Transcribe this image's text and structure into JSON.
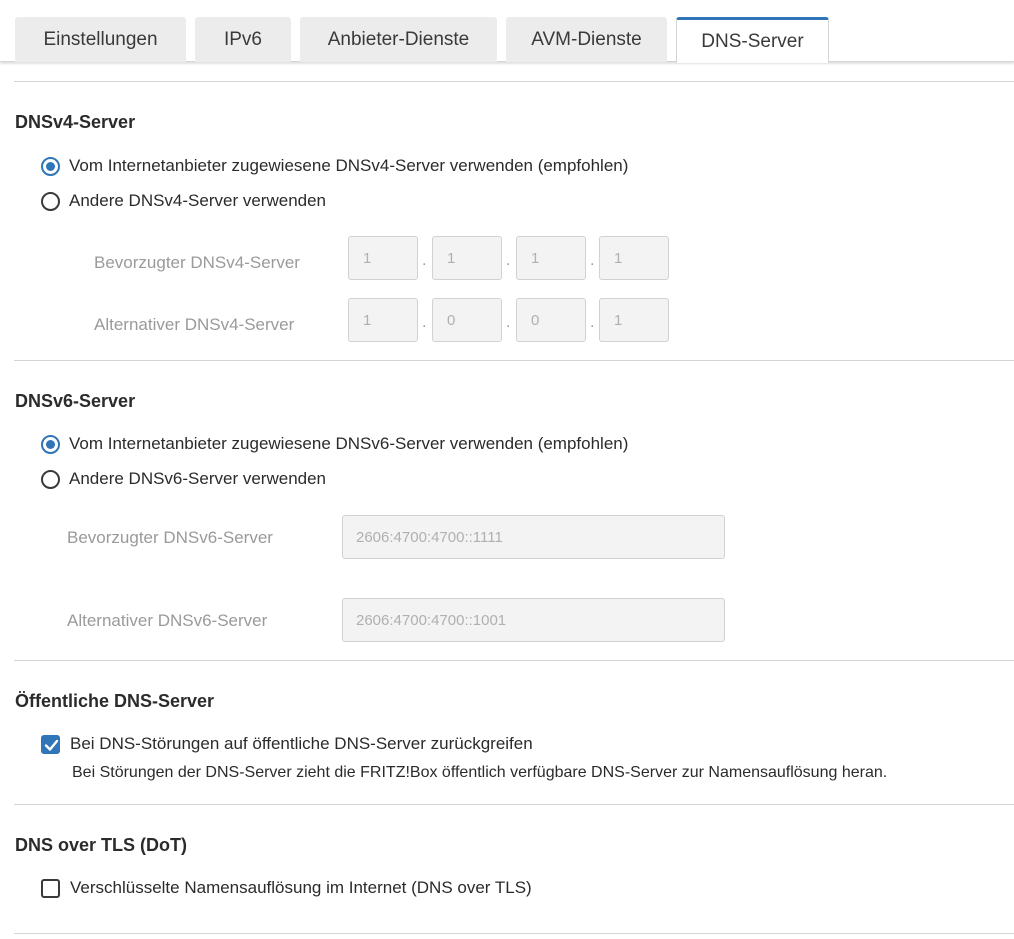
{
  "tabs": [
    {
      "label": "Einstellungen",
      "active": false
    },
    {
      "label": "IPv6",
      "active": false
    },
    {
      "label": "Anbieter-Dienste",
      "active": false
    },
    {
      "label": "AVM-Dienste",
      "active": false
    },
    {
      "label": "DNS-Server",
      "active": true
    }
  ],
  "dnsv4": {
    "title": "DNSv4-Server",
    "option_provider": "Vom Internetanbieter zugewiesene DNSv4-Server verwenden (empfohlen)",
    "option_custom": "Andere DNSv4-Server verwenden",
    "selected": "provider",
    "preferred_label": "Bevorzugter DNSv4-Server",
    "preferred": [
      "1",
      "1",
      "1",
      "1"
    ],
    "alternative_label": "Alternativer DNSv4-Server",
    "alternative": [
      "1",
      "0",
      "0",
      "1"
    ]
  },
  "dnsv6": {
    "title": "DNSv6-Server",
    "option_provider": "Vom Internetanbieter zugewiesene DNSv6-Server verwenden (empfohlen)",
    "option_custom": "Andere DNSv6-Server verwenden",
    "selected": "provider",
    "preferred_label": "Bevorzugter DNSv6-Server",
    "preferred": "2606:4700:4700::1111",
    "alternative_label": "Alternativer DNSv6-Server",
    "alternative": "2606:4700:4700::1001"
  },
  "public_dns": {
    "title": "Öffentliche DNS-Server",
    "checkbox_label": "Bei DNS-Störungen auf öffentliche DNS-Server zurückgreifen",
    "checked": true,
    "hint": "Bei Störungen der DNS-Server zieht die FRITZ!Box öffentlich verfügbare DNS-Server zur Namensauflösung heran."
  },
  "dot": {
    "title": "DNS over TLS (DoT)",
    "checkbox_label": "Verschlüsselte Namensauflösung im Internet (DNS over TLS)",
    "checked": false
  },
  "colors": {
    "accent": "#2f75b8",
    "tab_inactive": "#ececec",
    "input_bg": "#f3f3f3",
    "label_disabled": "#9a9a9a"
  }
}
